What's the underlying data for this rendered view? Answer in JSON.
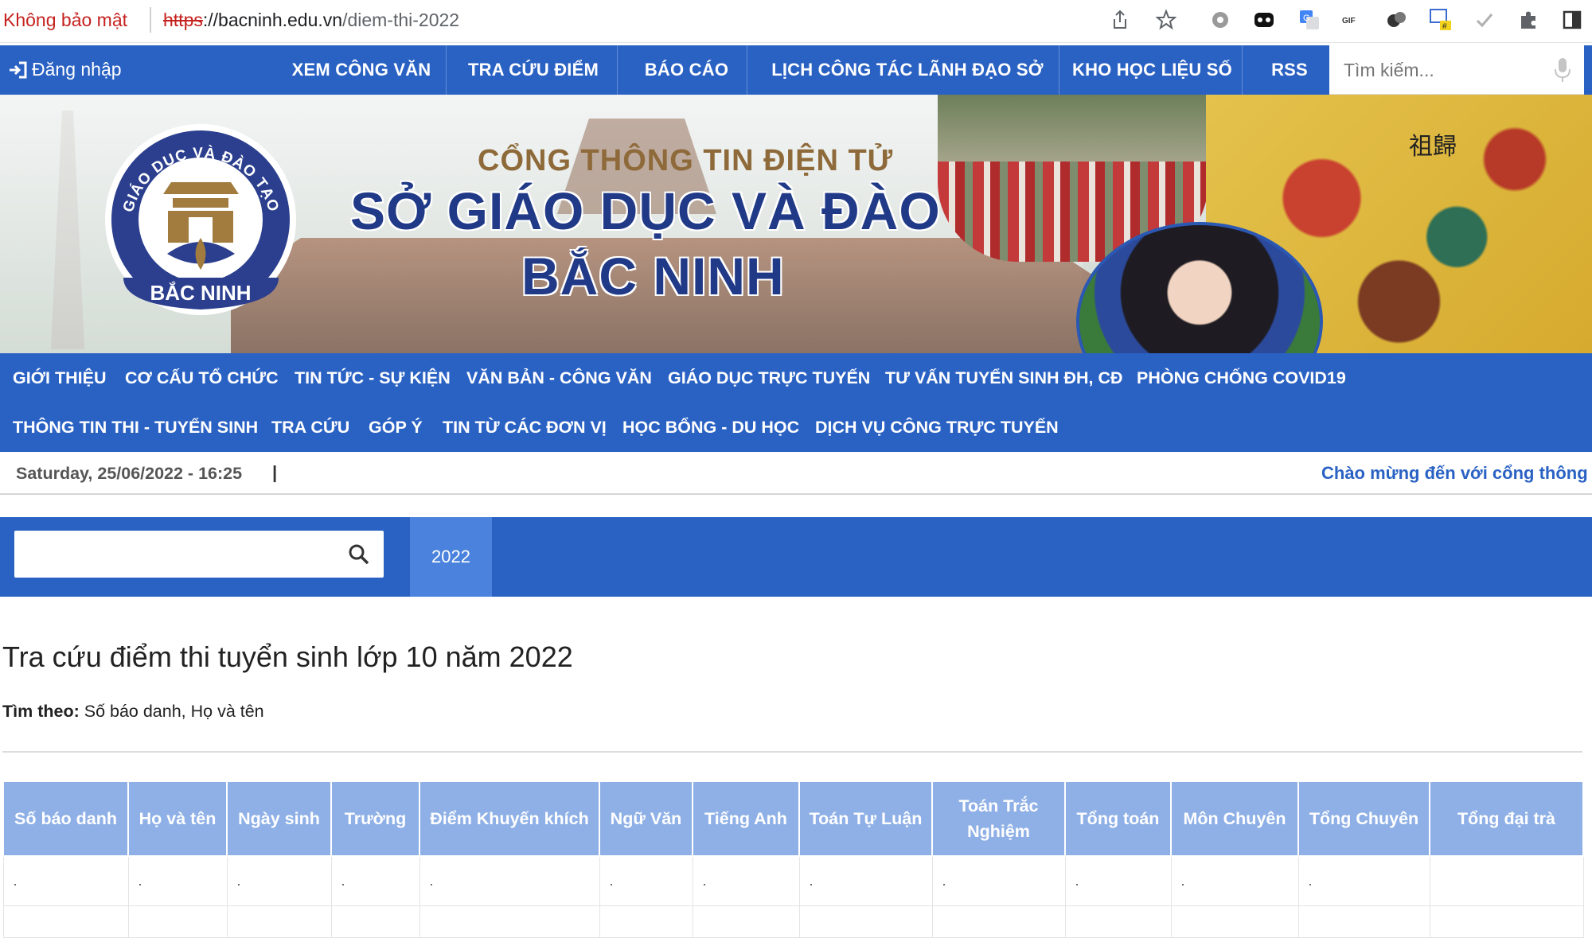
{
  "browser": {
    "security_label": "Không bảo mật",
    "url_scheme": "https",
    "url_sep": "://",
    "url_host": "bacninh.edu.vn",
    "url_path": "/diem-thi-2022"
  },
  "top_nav": {
    "login_label": "Đăng nhập",
    "links": [
      "XEM CÔNG VĂN",
      "TRA CỨU ĐIỂM",
      "BÁO CÁO",
      "LỊCH CÔNG TÁC LÃNH ĐẠO SỞ",
      "KHO HỌC LIỆU SỐ",
      "RSS"
    ],
    "search_placeholder": "Tìm kiếm..."
  },
  "banner": {
    "subtitle": "CỔNG THÔNG TIN ĐIỆN TỬ",
    "title_line1": "SỞ GIÁO DỤC VÀ ĐÀO TẠO",
    "title_line2": "BẮC NINH",
    "logo_top_text": "GIÁO DỤC VÀ ĐÀO TẠO",
    "logo_bottom_text": "BẮC NINH",
    "painting_text": "祖歸"
  },
  "main_nav": {
    "row1": [
      "GIỚI THIỆU",
      "CƠ CẤU TỔ CHỨC",
      "TIN TỨC - SỰ KIỆN",
      "VĂN BẢN - CÔNG VĂN",
      "GIÁO DỤC TRỰC TUYẾN",
      "TƯ VẤN TUYỂN SINH ĐH, CĐ",
      "PHÒNG CHỐNG COVID19"
    ],
    "row2": [
      "THÔNG TIN THI - TUYỂN SINH",
      "TRA CỨU",
      "GÓP Ý",
      "TIN TỪ CÁC ĐƠN VỊ",
      "HỌC BỔNG - DU HỌC",
      "DỊCH VỤ CÔNG TRỰC TUYẾN"
    ]
  },
  "date_bar": {
    "date": "Saturday, 25/06/2022 - 16:25",
    "pipe": "|",
    "marquee": "Chào mừng đến với cổng thông tin"
  },
  "search_bar": {
    "value": "",
    "tab_label": "2022"
  },
  "content": {
    "title": "Tra cứu điểm thi tuyển sinh lớp 10 năm 2022",
    "find_by_label": "Tìm theo:",
    "find_by_value": " Số báo danh, Họ và tên"
  },
  "table": {
    "headers": [
      "Số báo danh",
      "Họ và tên",
      "Ngày sinh",
      "Trường",
      "Điểm Khuyến khích",
      "Ngữ Văn",
      "Tiếng Anh",
      "Toán Tự Luận",
      "Toán Trắc Nghiệm",
      "Tổng toán",
      "Môn Chuyên",
      "Tổng Chuyên",
      "Tổng đại trà"
    ],
    "row1": [
      ".",
      ".",
      ".",
      ".",
      ".",
      ".",
      ".",
      ".",
      ".",
      ".",
      ".",
      ".",
      ""
    ],
    "row2": [
      "",
      "",
      "",
      "",
      "",
      "",
      "",
      "",
      "",
      "",
      "",
      "",
      ""
    ]
  },
  "colors": {
    "brand_blue": "#2a62c4",
    "header_blue": "#8fb0e6",
    "active_tab": "#4a82dd",
    "warning_red": "#c5221f"
  }
}
